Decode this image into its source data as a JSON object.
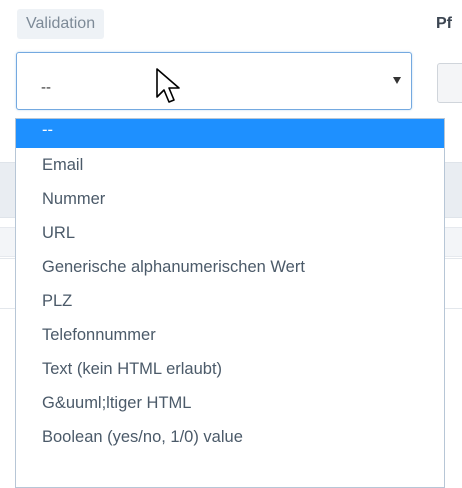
{
  "validation": {
    "label": "Validation",
    "selected_value": "--",
    "options": [
      "--",
      "Email",
      "Nummer",
      "URL",
      "Generische alphanumerischen Wert",
      "PLZ",
      "Telefonnummer",
      "Text (kein HTML erlaubt)",
      "G&uuml;ltiger HTML",
      "Boolean (yes/no, 1/0) value"
    ]
  },
  "next_field": {
    "label_partial": "Pf"
  },
  "icons": {
    "dropdown": "triangle-down-icon",
    "cursor": "mouse-pointer-icon"
  },
  "colors": {
    "selected_option_bg": "#1e90ff",
    "select_border": "#74a9e0",
    "label_bg": "#eef2f6"
  }
}
